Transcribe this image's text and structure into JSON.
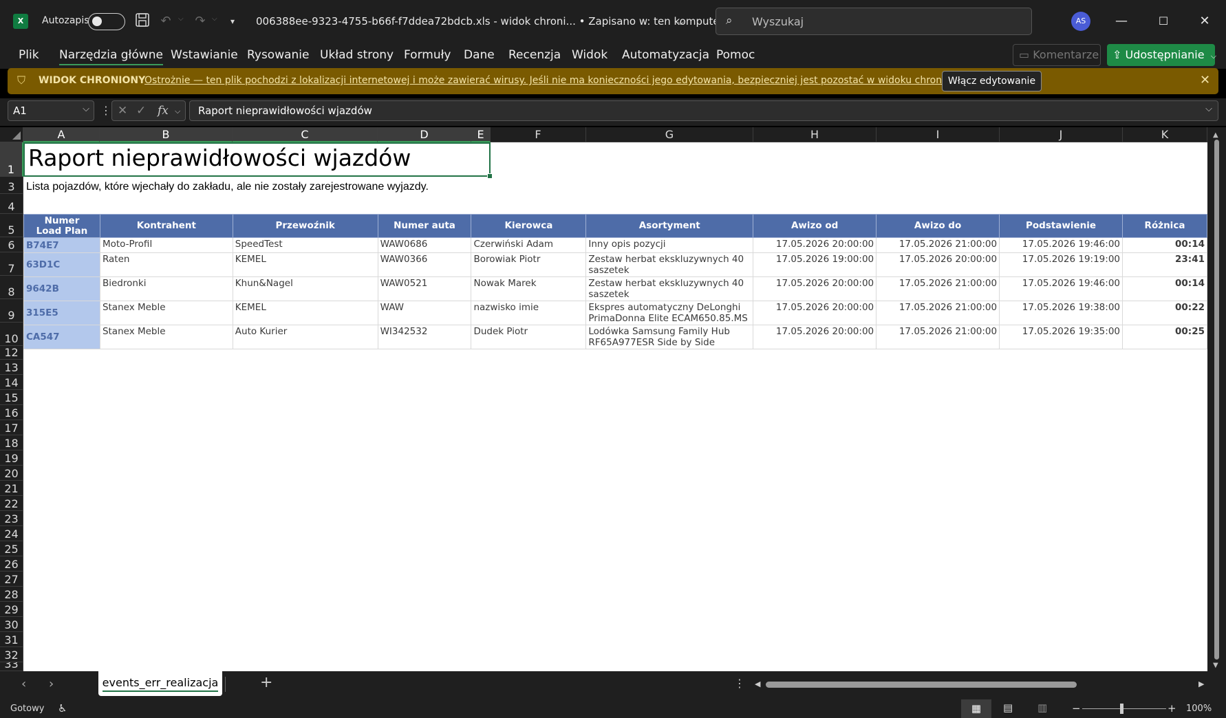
{
  "titlebar": {
    "app_icon": "X",
    "autosave_label": "Autozapis",
    "document_title": "006388ee-9323-4755-b66f-f7ddea72bdcb.xls  -  widok chroni...  •  Zapisano w: ten komputer",
    "search_placeholder": "Wyszukaj",
    "avatar_initials": "AS"
  },
  "ribbon": {
    "tabs": [
      "Plik",
      "Narzędzia główne",
      "Wstawianie",
      "Rysowanie",
      "Układ strony",
      "Formuły",
      "Dane",
      "Recenzja",
      "Widok",
      "Automatyzacja",
      "Pomoc"
    ],
    "active_tab": "Narzędzia główne",
    "comments_label": "Komentarze",
    "share_label": "Udostępnianie"
  },
  "protected_view": {
    "title": "WIDOK CHRONIONY",
    "message": "Ostrożnie — ten plik pochodzi z lokalizacji internetowej i może zawierać wirusy. Jeśli nie ma konieczności jego edytowania, bezpieczniej jest pozostać w widoku chronionym.",
    "enable_label": "Włącz edytowanie"
  },
  "formula_bar": {
    "name_box": "A1",
    "fx": "fx",
    "content": "Raport nieprawidłowości wjazdów"
  },
  "grid": {
    "columns": [
      "A",
      "B",
      "C",
      "D",
      "E",
      "F",
      "G",
      "H",
      "I",
      "J",
      "K"
    ],
    "rows": [
      "1",
      "3",
      "4",
      "5",
      "6",
      "7",
      "8",
      "9",
      "10",
      "12",
      "13",
      "14",
      "15",
      "16",
      "17",
      "18",
      "19",
      "20",
      "21",
      "22",
      "23",
      "24",
      "25",
      "26",
      "27",
      "28",
      "29",
      "30",
      "31",
      "32",
      "33"
    ]
  },
  "sheet": {
    "title": "Raport nieprawidłowości wjazdów",
    "subtitle": "Lista pojazdów, które wjechały do zakładu, ale nie zostały zarejestrowane wyjazdy.",
    "headers": [
      "Numer Load Plan",
      "Kontrahent",
      "Przewoźnik",
      "Numer auta",
      "Kierowca",
      "Asortyment",
      "Awizo od",
      "Awizo do",
      "Podstawienie",
      "Różnica"
    ],
    "records": [
      {
        "id": "B74E7",
        "kontrahent": "Moto-Profil",
        "przewoznik": "SpeedTest",
        "auto": "WAW0686",
        "kierowca": "Czerwiński Adam",
        "asortyment": "Inny opis pozycji",
        "od": "17.05.2026 20:00:00",
        "do": "17.05.2026 21:00:00",
        "podstawienie": "17.05.2026 19:46:00",
        "roznica": "00:14"
      },
      {
        "id": "63D1C",
        "kontrahent": "Raten",
        "przewoznik": "KEMEL",
        "auto": "WAW0366",
        "kierowca": "Borowiak Piotr",
        "asortyment": "Zestaw herbat ekskluzywnych 40 saszetek",
        "od": "17.05.2026 19:00:00",
        "do": "17.05.2026 20:00:00",
        "podstawienie": "17.05.2026 19:19:00",
        "roznica": "23:41"
      },
      {
        "id": "9642B",
        "kontrahent": "Biedronki",
        "przewoznik": "Khun&Nagel",
        "auto": "WAW0521",
        "kierowca": "Nowak Marek",
        "asortyment": "Zestaw herbat ekskluzywnych 40 saszetek",
        "od": "17.05.2026 20:00:00",
        "do": "17.05.2026 21:00:00",
        "podstawienie": "17.05.2026 19:46:00",
        "roznica": "00:14"
      },
      {
        "id": "315E5",
        "kontrahent": "Stanex Meble",
        "przewoznik": "KEMEL",
        "auto": "WAW",
        "kierowca": "nazwisko imie",
        "asortyment": "Ekspres automatyczny DeLonghi PrimaDonna Elite ECAM650.85.MS",
        "od": "17.05.2026 20:00:00",
        "do": "17.05.2026 21:00:00",
        "podstawienie": "17.05.2026 19:38:00",
        "roznica": "00:22"
      },
      {
        "id": "CA547",
        "kontrahent": "Stanex Meble",
        "przewoznik": "Auto Kurier",
        "auto": "WI342532",
        "kierowca": "Dudek Piotr",
        "asortyment": "Lodówka Samsung Family Hub RF65A977ESR Side by Side",
        "od": "17.05.2026 20:00:00",
        "do": "17.05.2026 21:00:00",
        "podstawienie": "17.05.2026 19:35:00",
        "roznica": "00:25"
      }
    ]
  },
  "sheet_tabs": {
    "active": "events_err_realizacja"
  },
  "status": {
    "text": "Gotowy",
    "zoom": "100%"
  },
  "colors": {
    "accent": "#217346",
    "header_blue": "#4e6ca8",
    "id_cell": "#b3c8ec",
    "protected_bar": "#7a5a00",
    "share": "#1e8a46"
  }
}
